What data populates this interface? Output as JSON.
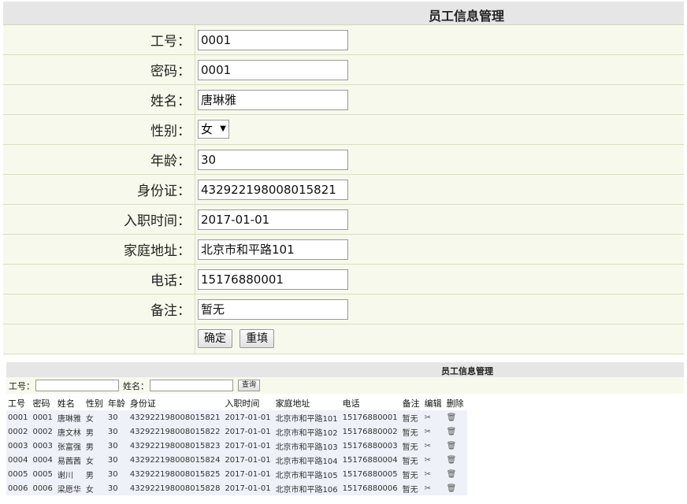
{
  "form": {
    "title": "员工信息管理",
    "fields": [
      {
        "label": "工号：",
        "value": "0001"
      },
      {
        "label": "密码：",
        "value": "0001"
      },
      {
        "label": "姓名：",
        "value": "唐琳雅"
      },
      {
        "label": "性别：",
        "value": "女"
      },
      {
        "label": "年龄：",
        "value": "30"
      },
      {
        "label": "身份证：",
        "value": "432922198008015821"
      },
      {
        "label": "入职时间：",
        "value": "2017-01-01"
      },
      {
        "label": "家庭地址：",
        "value": "北京市和平路101"
      },
      {
        "label": "电话：",
        "value": "15176880001"
      },
      {
        "label": "备注：",
        "value": "暂无"
      }
    ],
    "confirm_label": "确定",
    "reset_label": "重填"
  },
  "list": {
    "title": "员工信息管理",
    "search_id_label": "工号：",
    "search_name_label": "姓名：",
    "search_button": "查询",
    "headers": [
      "工号",
      "密码",
      "姓名",
      "性别",
      "年龄",
      "身份证",
      "入职时间",
      "家庭地址",
      "电话",
      "备注",
      "编辑",
      "删除"
    ],
    "rows": [
      [
        "0001",
        "0001",
        "唐琳雅",
        "女",
        "30",
        "432922198008015821",
        "2017-01-01",
        "北京市和平路101",
        "15176880001",
        "暂无"
      ],
      [
        "0002",
        "0002",
        "唐文林",
        "男",
        "30",
        "432922198008015822",
        "2017-01-01",
        "北京市和平路102",
        "15176880002",
        "暂无"
      ],
      [
        "0003",
        "0003",
        "张富强",
        "男",
        "30",
        "432922198008015823",
        "2017-01-01",
        "北京市和平路103",
        "15176880003",
        "暂无"
      ],
      [
        "0004",
        "0004",
        "易茜茜",
        "女",
        "30",
        "432922198008015824",
        "2017-01-01",
        "北京市和平路104",
        "15176880004",
        "暂无"
      ],
      [
        "0005",
        "0005",
        "谢川",
        "男",
        "30",
        "432922198008015825",
        "2017-01-01",
        "北京市和平路105",
        "15176880005",
        "暂无"
      ],
      [
        "0006",
        "0006",
        "梁愿华",
        "女",
        "30",
        "432922198008015828",
        "2017-01-01",
        "北京市和平路106",
        "15176880006",
        "暂无"
      ]
    ],
    "edit_icon": "edit-tool-icon",
    "delete_icon": "trash-icon"
  }
}
